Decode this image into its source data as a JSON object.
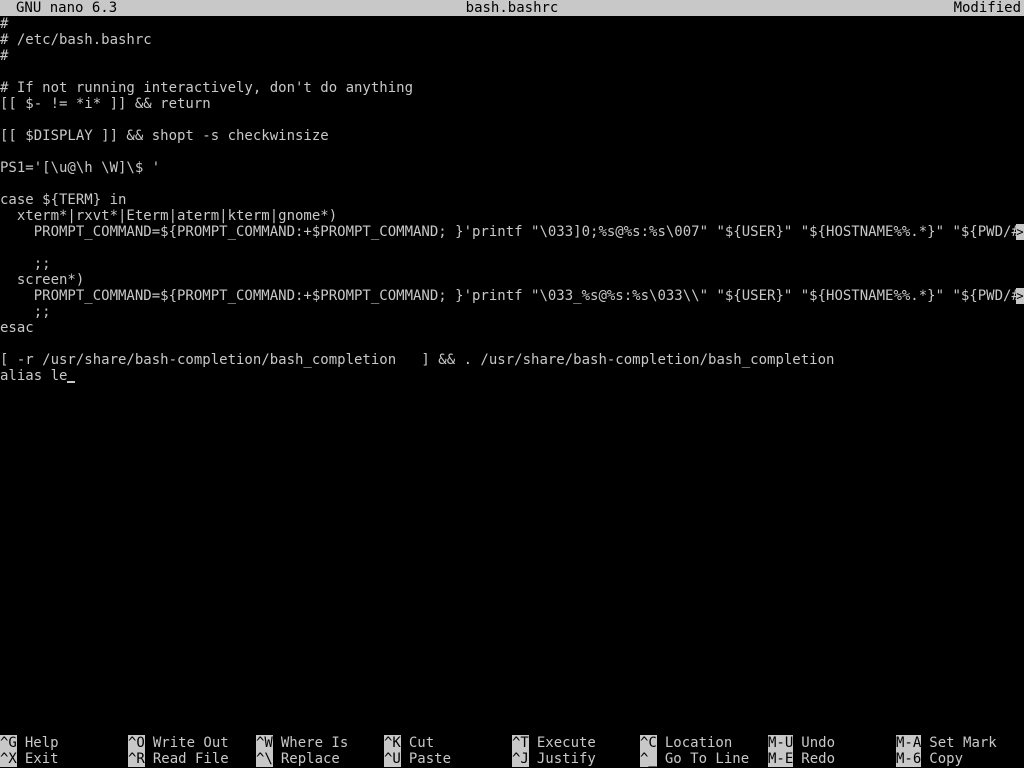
{
  "app": {
    "name": "GNU nano 6.3",
    "filename": "bash.bashrc",
    "state": "Modified"
  },
  "editor": {
    "lines": [
      "#",
      "# /etc/bash.bashrc",
      "#",
      "",
      "# If not running interactively, don't do anything",
      "[[ $- != *i* ]] && return",
      "",
      "[[ $DISPLAY ]] && shopt -s checkwinsize",
      "",
      "PS1='[\\u@\\h \\W]\\$ '",
      "",
      "case ${TERM} in",
      "  xterm*|rxvt*|Eterm|aterm|kterm|gnome*)",
      "    PROMPT_COMMAND=${PROMPT_COMMAND:+$PROMPT_COMMAND; }'printf \"\\033]0;%s@%s:%s\\007\" \"${USER}\" \"${HOSTNAME%%.*}\" \"${PWD/#$HOME/",
      "",
      "    ;;",
      "  screen*)",
      "    PROMPT_COMMAND=${PROMPT_COMMAND:+$PROMPT_COMMAND; }'printf \"\\033_%s@%s:%s\\033\\\\\" \"${USER}\" \"${HOSTNAME%%.*}\" \"${PWD/#$HOME/",
      "    ;;",
      "esac",
      "",
      "[ -r /usr/share/bash-completion/bash_completion   ] && . /usr/share/bash-completion/bash_completion",
      "alias le"
    ],
    "overflow_marker": ">"
  },
  "shortcuts": {
    "row1": [
      {
        "key": "^G",
        "label": "Help"
      },
      {
        "key": "^O",
        "label": "Write Out"
      },
      {
        "key": "^W",
        "label": "Where Is"
      },
      {
        "key": "^K",
        "label": "Cut"
      },
      {
        "key": "^T",
        "label": "Execute"
      },
      {
        "key": "^C",
        "label": "Location"
      },
      {
        "key": "M-U",
        "label": "Undo"
      },
      {
        "key": "M-A",
        "label": "Set Mark"
      }
    ],
    "row2": [
      {
        "key": "^X",
        "label": "Exit"
      },
      {
        "key": "^R",
        "label": "Read File"
      },
      {
        "key": "^\\",
        "label": "Replace"
      },
      {
        "key": "^U",
        "label": "Paste"
      },
      {
        "key": "^J",
        "label": "Justify"
      },
      {
        "key": "^_",
        "label": "Go To Line"
      },
      {
        "key": "M-E",
        "label": "Redo"
      },
      {
        "key": "M-6",
        "label": "Copy"
      }
    ]
  }
}
